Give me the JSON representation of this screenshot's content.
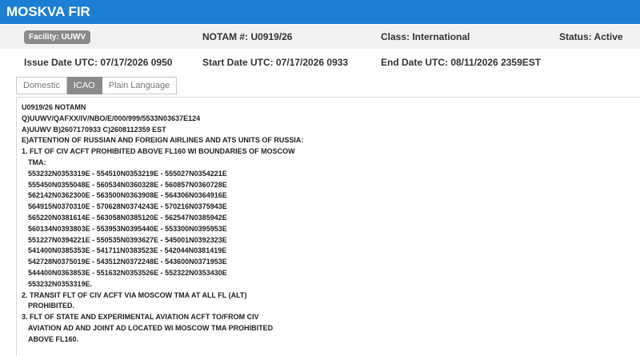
{
  "header": {
    "title": "MOSKVA FIR"
  },
  "summary": {
    "facility": "Facility: UUWV",
    "notam_number": "NOTAM #: U0919/26",
    "class": "Class: International",
    "status": "Status: Active"
  },
  "dates": {
    "issue": "Issue Date UTC: 07/17/2026 0950",
    "start": "Start Date UTC: 07/17/2026 0933",
    "end": "End Date UTC: 08/11/2026 2359EST"
  },
  "tabs": {
    "domestic": "Domestic",
    "icao": "ICAO",
    "plain_language": "Plain Language",
    "active": "ICAO"
  },
  "notam_lines": [
    "U0919/26 NOTAMN",
    "Q)UUWV/QAFXX/IV/NBO/E/000/999/5533N03637E124",
    "A)UUWV B)2607170933 C)2608112359 EST",
    "E)ATTENTION OF RUSSIAN AND FOREIGN AIRLINES AND ATS UNITS OF RUSSIA:",
    "1. FLT OF CIV ACFT PROHIBITED ABOVE FL160 WI BOUNDARIES OF MOSCOW",
    "TMA:",
    "553232N0353319E - 554510N0353219E - 555027N0354221E",
    "555450N0355048E - 560534N0360328E - 560857N0360728E",
    "562142N0362300E - 563500N0363908E - 564306N0364916E",
    "564915N0370310E - 570628N0374243E - 570216N0375943E",
    "565220N0381614E - 563058N0385120E - 562547N0385942E",
    "560134N0393803E - 553953N0395440E - 553300N0395953E",
    "551227N0394221E - 550535N0393627E - 545001N0392323E",
    "541400N0385353E - 541711N0383523E - 542044N0381419E",
    "542728N0375019E - 543512N0372248E - 543600N0371953E",
    "544400N0363853E - 551632N0353526E - 552322N0353430E",
    "553232N0353319E.",
    "2. TRANSIT FLT OF CIV ACFT VIA MOSCOW TMA AT ALL FL (ALT)",
    "PROHIBITED.",
    "3. FLT OF STATE AND EXPERIMENTAL AVIATION ACFT TO/FROM CIV",
    "AVIATION AD AND JOINT AD LOCATED WI MOSCOW TMA PROHIBITED",
    "ABOVE FL160."
  ]
}
